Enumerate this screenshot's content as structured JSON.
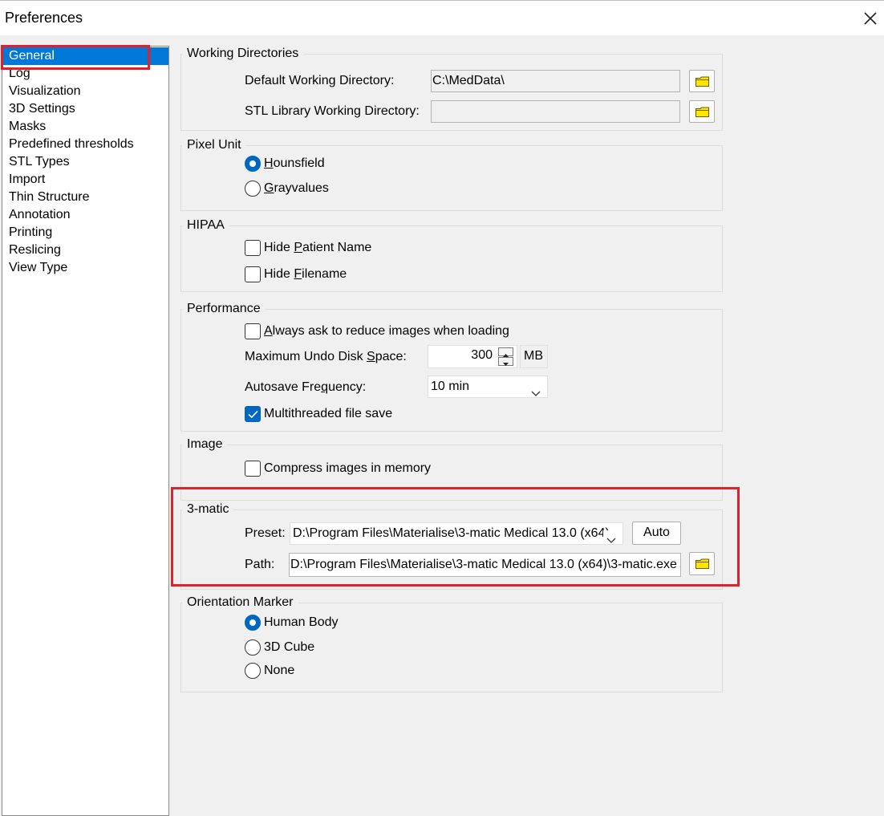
{
  "window": {
    "title": "Preferences"
  },
  "sidebar": {
    "items": [
      {
        "label": "General",
        "selected": true
      },
      {
        "label": "Log"
      },
      {
        "label": "Visualization"
      },
      {
        "label": "3D Settings"
      },
      {
        "label": "Masks"
      },
      {
        "label": "Predefined thresholds"
      },
      {
        "label": "STL Types"
      },
      {
        "label": "Import"
      },
      {
        "label": "Thin Structure"
      },
      {
        "label": "Annotation"
      },
      {
        "label": "Printing"
      },
      {
        "label": "Reslicing"
      },
      {
        "label": "View Type"
      }
    ]
  },
  "working_directories": {
    "title": "Working Directories",
    "default_label": "Default Working Directory:",
    "default_value": "C:\\MedData\\",
    "stl_label": "STL Library Working Directory:",
    "stl_value": ""
  },
  "pixel_unit": {
    "title": "Pixel Unit",
    "options": [
      {
        "label": "Hounsfield",
        "selected": true
      },
      {
        "label": "Grayvalues",
        "selected": false
      }
    ]
  },
  "hipaa": {
    "title": "HIPAA",
    "hide_patient_name": {
      "label": "Hide Patient Name",
      "checked": false
    },
    "hide_filename": {
      "label": "Hide Filename",
      "checked": false
    }
  },
  "performance": {
    "title": "Performance",
    "always_ask": {
      "label": "Always ask to reduce images when loading",
      "checked": false
    },
    "undo_label": "Maximum Undo Disk Space:",
    "undo_value": "300",
    "undo_unit": "MB",
    "autosave_label": "Autosave Frequency:",
    "autosave_value": "10 min",
    "multithreaded": {
      "label": "Multithreaded file save",
      "checked": true
    }
  },
  "image": {
    "title": "Image",
    "compress": {
      "label": "Compress images in memory",
      "checked": false
    }
  },
  "three_matic": {
    "title": "3-matic",
    "preset_label": "Preset:",
    "preset_value": "D:\\Program Files\\Materialise\\3-matic Medical 13.0 (x64)",
    "auto_label": "Auto",
    "path_label": "Path:",
    "path_value": "D:\\Program Files\\Materialise\\3-matic Medical 13.0 (x64)\\3-matic.exe"
  },
  "orientation_marker": {
    "title": "Orientation Marker",
    "options": [
      {
        "label": "Human Body",
        "selected": true
      },
      {
        "label": "3D Cube",
        "selected": false
      },
      {
        "label": "None",
        "selected": false
      }
    ]
  },
  "colors": {
    "accent": "#0078d7",
    "radio_checked": "#0067c0",
    "highlight_box": "#e0202a",
    "folder": "#ffe600"
  },
  "icons": [
    "close-icon",
    "folder-icon",
    "chevron-down-icon",
    "spin-up-icon",
    "spin-down-icon",
    "check-icon"
  ]
}
